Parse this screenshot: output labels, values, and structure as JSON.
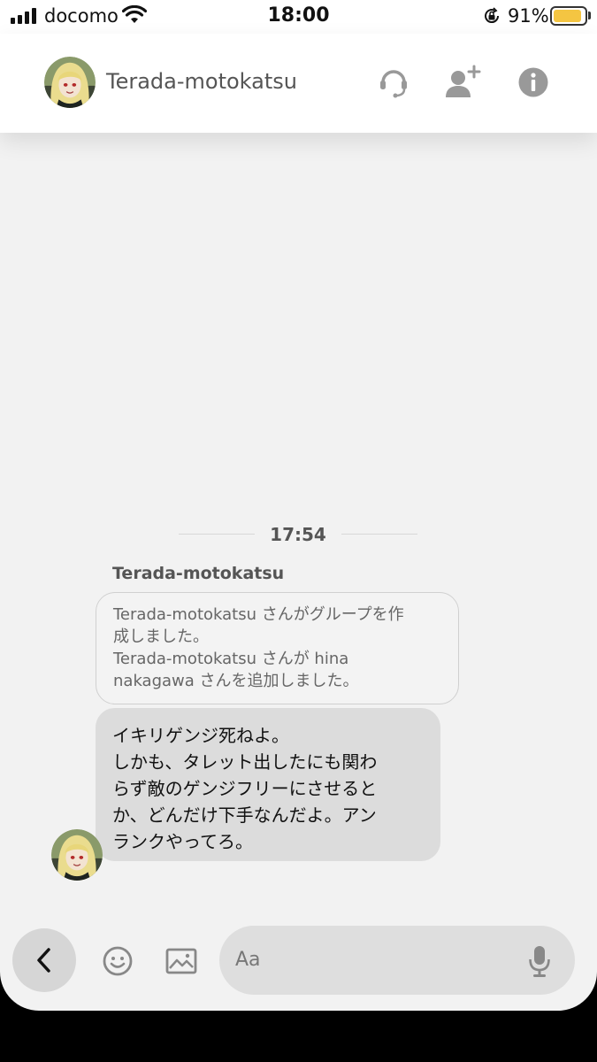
{
  "status_bar": {
    "carrier": "docomo",
    "time": "18:00",
    "battery_percent": "91%",
    "battery_level": 0.91,
    "battery_color": "#f4c542",
    "icons": [
      "signal-icon",
      "wifi-icon",
      "orientation-lock-icon",
      "battery-icon"
    ]
  },
  "header": {
    "title": "Terada-motokatsu",
    "icons": [
      "headset-icon",
      "add-friend-icon",
      "info-icon"
    ]
  },
  "chat": {
    "timestamp": "17:54",
    "sender_name": "Terada-motokatsu",
    "system_message_lines": [
      "Terada-motokatsu さんがグループを作",
      "成しました。",
      "Terada-motokatsu さんが hina",
      "nakagawa さんを追加しました。"
    ],
    "message_lines": [
      "イキリゲンジ死ねよ。",
      "しかも、タレット出したにも関わ",
      "らず敵のゲンジフリーにさせると",
      "か、どんだけ下手なんだよ。アン",
      "ランクやってろ。"
    ]
  },
  "input_bar": {
    "placeholder": "Aa",
    "icons": [
      "back-icon",
      "emoji-icon",
      "image-icon",
      "microphone-icon"
    ]
  }
}
